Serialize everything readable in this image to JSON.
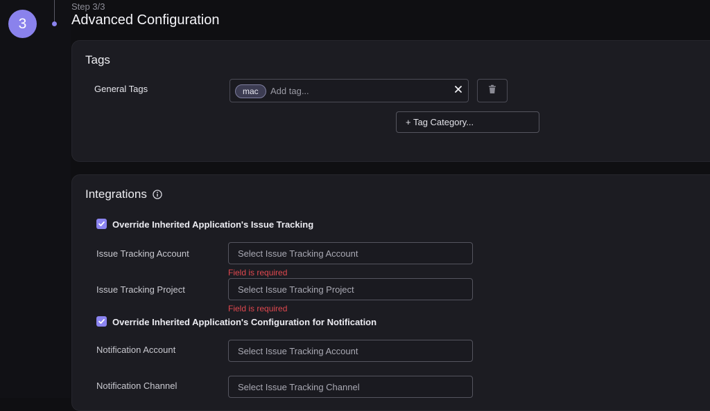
{
  "stepper": {
    "number": "3",
    "step_label": "Step 3/3",
    "title": "Advanced Configuration"
  },
  "tags": {
    "title": "Tags",
    "general_label": "General Tags",
    "chip": "mac",
    "placeholder": "Add tag...",
    "category_button": "+ Tag Category..."
  },
  "integrations": {
    "title": "Integrations",
    "override_issue_label": "Override Inherited Application's Issue Tracking",
    "override_issue_checked": true,
    "issue_account_label": "Issue Tracking Account",
    "issue_account_placeholder": "Select Issue Tracking Account",
    "issue_account_error": "Field is required",
    "issue_project_label": "Issue Tracking Project",
    "issue_project_placeholder": "Select Issue Tracking Project",
    "issue_project_error": "Field is required",
    "override_notification_label": "Override Inherited Application's Configuration for Notification",
    "override_notification_checked": true,
    "notif_account_label": "Notification Account",
    "notif_account_placeholder": "Select Issue Tracking Account",
    "notif_channel_label": "Notification Channel",
    "notif_channel_placeholder": "Select Issue Tracking Channel"
  },
  "colors": {
    "accent": "#8a82ec",
    "error": "#e0484f",
    "card": "#1c1c22",
    "background": "#0f0f12"
  },
  "icons": [
    "check-icon",
    "clear-icon",
    "trash-icon",
    "info-icon"
  ]
}
